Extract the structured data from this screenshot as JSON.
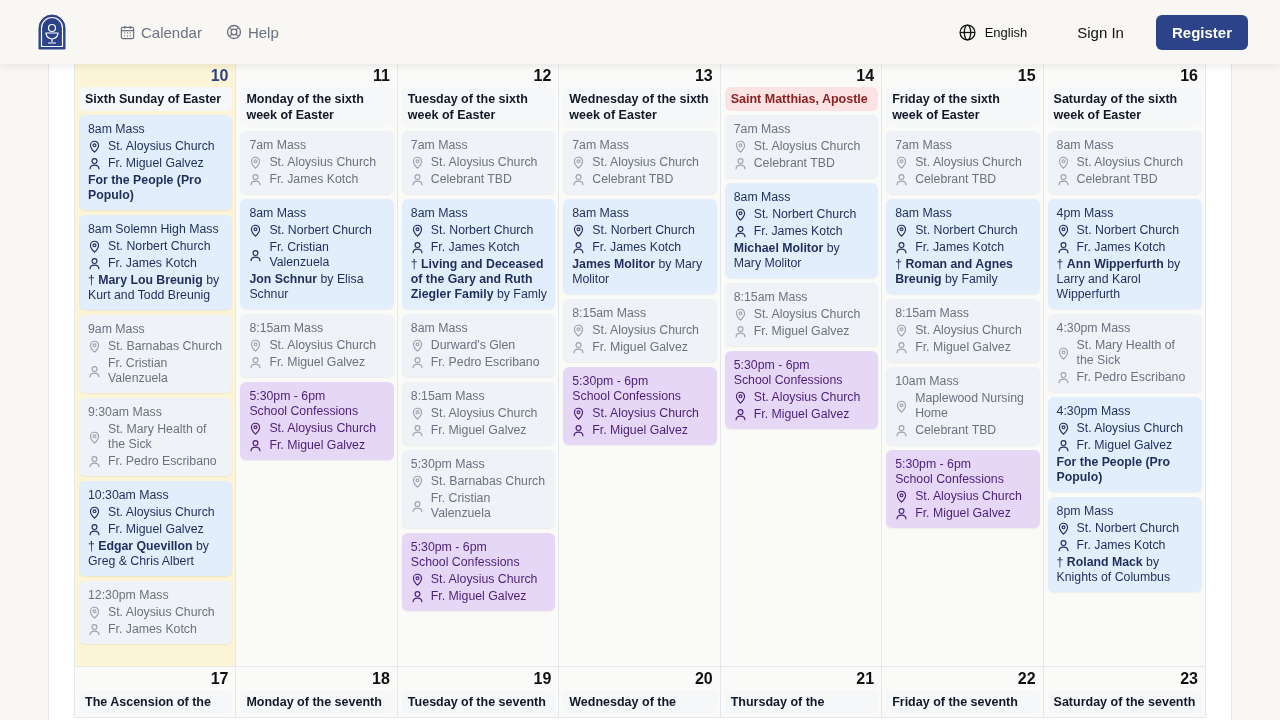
{
  "header": {
    "nav": [
      {
        "label": "Calendar",
        "kind": "calendar"
      },
      {
        "label": "Help",
        "kind": "help"
      }
    ],
    "language": "English",
    "sign_in": "Sign In",
    "register": "Register"
  },
  "weeks": [
    {
      "days": [
        {
          "date": "10",
          "title": "Sixth Sunday of Easter",
          "feast": false,
          "highlighted": true,
          "events": [
            {
              "kind": "mass",
              "time": "8am Mass",
              "place": "St. Aloysius Church",
              "celebrant": "Fr. Miguel Galvez",
              "intention": "**For the People (Pro Populo)**",
              "highlighted": true
            },
            {
              "kind": "mass",
              "time": "8am Solemn High Mass",
              "place": "St. Norbert Church",
              "celebrant": "Fr. James Kotch",
              "intention": "† **Mary Lou Breunig** by Kurt and Todd Breunig",
              "highlighted": true
            },
            {
              "kind": "mass",
              "time": "9am Mass",
              "place": "St. Barnabas Church",
              "celebrant": "Fr. Cristian Valenzuela",
              "highlighted": false
            },
            {
              "kind": "mass",
              "time": "9:30am Mass",
              "place": "St. Mary Health of the Sick",
              "celebrant": "Fr. Pedro Escribano",
              "highlighted": false
            },
            {
              "kind": "mass",
              "time": "10:30am Mass",
              "place": "St. Aloysius Church",
              "celebrant": "Fr. Miguel Galvez",
              "intention": "† **Edgar Quevillon** by Greg & Chris Albert",
              "highlighted": true
            },
            {
              "kind": "mass",
              "time": "12:30pm Mass",
              "place": "St. Aloysius Church",
              "celebrant": "Fr. James Kotch",
              "highlighted": false
            }
          ]
        },
        {
          "date": "11",
          "title": "Monday of the sixth week of Easter",
          "feast": false,
          "highlighted": false,
          "events": [
            {
              "kind": "mass",
              "time": "7am Mass",
              "place": "St. Aloysius Church",
              "celebrant": "Fr. James Kotch",
              "highlighted": false
            },
            {
              "kind": "mass",
              "time": "8am Mass",
              "place": "St. Norbert Church",
              "celebrant": "Fr. Cristian Valenzuela",
              "intention": "**Jon Schnur** by Elisa Schnur",
              "highlighted": true
            },
            {
              "kind": "mass",
              "time": "8:15am Mass",
              "place": "St. Aloysius Church",
              "celebrant": "Fr. Miguel Galvez",
              "highlighted": false
            },
            {
              "kind": "confession",
              "time": "5:30pm - 6pm",
              "name": "School Confessions",
              "place": "St. Aloysius Church",
              "celebrant": "Fr. Miguel Galvez"
            }
          ]
        },
        {
          "date": "12",
          "title": "Tuesday of the sixth week of Easter",
          "feast": false,
          "highlighted": false,
          "events": [
            {
              "kind": "mass",
              "time": "7am Mass",
              "place": "St. Aloysius Church",
              "celebrant": "Celebrant TBD",
              "highlighted": false
            },
            {
              "kind": "mass",
              "time": "8am Mass",
              "place": "St. Norbert Church",
              "celebrant": "Fr. James Kotch",
              "intention": "† **Living and Deceased of the Gary and Ruth Ziegler Family** by Famly",
              "highlighted": true
            },
            {
              "kind": "mass",
              "time": "8am Mass",
              "place": "Durward's Glen",
              "celebrant": "Fr. Pedro Escribano",
              "highlighted": false
            },
            {
              "kind": "mass",
              "time": "8:15am Mass",
              "place": "St. Aloysius Church",
              "celebrant": "Fr. Miguel Galvez",
              "highlighted": false
            },
            {
              "kind": "mass",
              "time": "5:30pm Mass",
              "place": "St. Barnabas Church",
              "celebrant": "Fr. Cristian Valenzuela",
              "highlighted": false
            },
            {
              "kind": "confession",
              "time": "5:30pm - 6pm",
              "name": "School Confessions",
              "place": "St. Aloysius Church",
              "celebrant": "Fr. Miguel Galvez"
            }
          ]
        },
        {
          "date": "13",
          "title": "Wednesday of the sixth week of Easter",
          "feast": false,
          "highlighted": false,
          "events": [
            {
              "kind": "mass",
              "time": "7am Mass",
              "place": "St. Aloysius Church",
              "celebrant": "Celebrant TBD",
              "highlighted": false
            },
            {
              "kind": "mass",
              "time": "8am Mass",
              "place": "St. Norbert Church",
              "celebrant": "Fr. James Kotch",
              "intention": "**James Molitor** by Mary Molitor",
              "highlighted": true
            },
            {
              "kind": "mass",
              "time": "8:15am Mass",
              "place": "St. Aloysius Church",
              "celebrant": "Fr. Miguel Galvez",
              "highlighted": false
            },
            {
              "kind": "confession",
              "time": "5:30pm - 6pm",
              "name": "School Confessions",
              "place": "St. Aloysius Church",
              "celebrant": "Fr. Miguel Galvez"
            }
          ]
        },
        {
          "date": "14",
          "title": "Saint Matthias, Apostle",
          "feast": true,
          "highlighted": false,
          "events": [
            {
              "kind": "mass",
              "time": "7am Mass",
              "place": "St. Aloysius Church",
              "celebrant": "Celebrant TBD",
              "highlighted": false
            },
            {
              "kind": "mass",
              "time": "8am Mass",
              "place": "St. Norbert Church",
              "celebrant": "Fr. James Kotch",
              "intention": "**Michael Molitor** by Mary Molitor",
              "highlighted": true
            },
            {
              "kind": "mass",
              "time": "8:15am Mass",
              "place": "St. Aloysius Church",
              "celebrant": "Fr. Miguel Galvez",
              "highlighted": false
            },
            {
              "kind": "confession",
              "time": "5:30pm - 6pm",
              "name": "School Confessions",
              "place": "St. Aloysius Church",
              "celebrant": "Fr. Miguel Galvez"
            }
          ]
        },
        {
          "date": "15",
          "title": "Friday of the sixth week of Easter",
          "feast": false,
          "highlighted": false,
          "events": [
            {
              "kind": "mass",
              "time": "7am Mass",
              "place": "St. Aloysius Church",
              "celebrant": "Celebrant TBD",
              "highlighted": false
            },
            {
              "kind": "mass",
              "time": "8am Mass",
              "place": "St. Norbert Church",
              "celebrant": "Fr. James Kotch",
              "intention": "† **Roman and Agnes Breunig** by Family",
              "highlighted": true
            },
            {
              "kind": "mass",
              "time": "8:15am Mass",
              "place": "St. Aloysius Church",
              "celebrant": "Fr. Miguel Galvez",
              "highlighted": false
            },
            {
              "kind": "mass",
              "time": "10am Mass",
              "place": "Maplewood Nursing Home",
              "celebrant": "Celebrant TBD",
              "highlighted": false
            },
            {
              "kind": "confession",
              "time": "5:30pm - 6pm",
              "name": "School Confessions",
              "place": "St. Aloysius Church",
              "celebrant": "Fr. Miguel Galvez"
            }
          ]
        },
        {
          "date": "16",
          "title": "Saturday of the sixth week of Easter",
          "feast": false,
          "highlighted": false,
          "events": [
            {
              "kind": "mass",
              "time": "8am Mass",
              "place": "St. Aloysius Church",
              "celebrant": "Celebrant TBD",
              "highlighted": false
            },
            {
              "kind": "mass",
              "time": "4pm Mass",
              "place": "St. Norbert Church",
              "celebrant": "Fr. James Kotch",
              "intention": "† **Ann Wipperfurth** by Larry and Karol Wipperfurth",
              "highlighted": true
            },
            {
              "kind": "mass",
              "time": "4:30pm Mass",
              "place": "St. Mary Health of the Sick",
              "celebrant": "Fr. Pedro Escribano",
              "highlighted": false
            },
            {
              "kind": "mass",
              "time": "4:30pm Mass",
              "place": "St. Aloysius Church",
              "celebrant": "Fr. Miguel Galvez",
              "intention": "**For the People (Pro Populo)**",
              "highlighted": true
            },
            {
              "kind": "mass",
              "time": "8pm Mass",
              "place": "St. Norbert Church",
              "celebrant": "Fr. James Kotch",
              "intention": "† **Roland Mack** by Knights of Columbus",
              "highlighted": true
            }
          ]
        }
      ]
    },
    {
      "days": [
        {
          "date": "17",
          "title": "The Ascension of the",
          "feast": false,
          "highlighted": false
        },
        {
          "date": "18",
          "title": "Monday of the seventh",
          "feast": false,
          "highlighted": false
        },
        {
          "date": "19",
          "title": "Tuesday of the seventh",
          "feast": false,
          "highlighted": false
        },
        {
          "date": "20",
          "title": "Wednesday of the",
          "feast": false,
          "highlighted": false
        },
        {
          "date": "21",
          "title": "Thursday of the",
          "feast": false,
          "highlighted": false
        },
        {
          "date": "22",
          "title": "Friday of the seventh",
          "feast": false,
          "highlighted": false
        },
        {
          "date": "23",
          "title": "Saturday of the seventh",
          "feast": false,
          "highlighted": false
        }
      ]
    }
  ]
}
